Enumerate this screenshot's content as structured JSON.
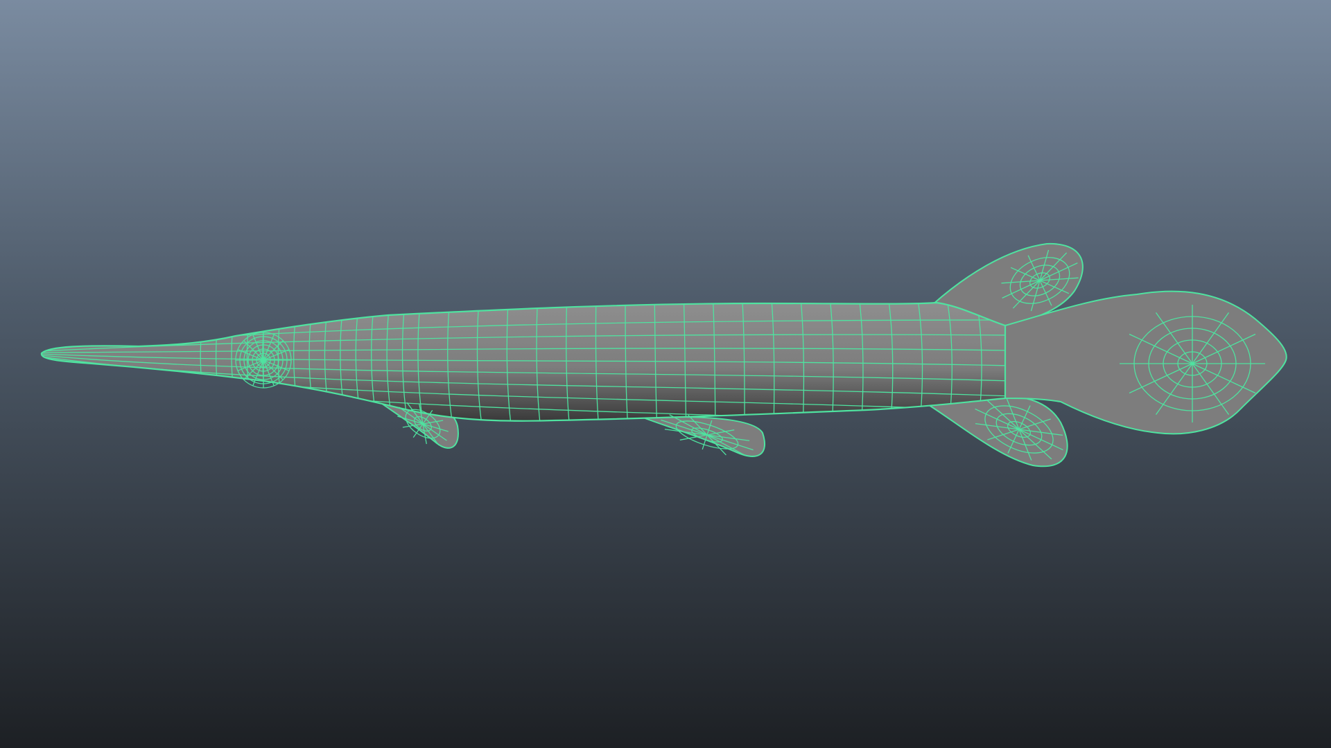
{
  "viewport": {
    "background_top": "#7a8ba0",
    "background_mid": "#4f5c6b",
    "background_bottom": "#1d2024"
  },
  "model": {
    "object": "fish-mesh",
    "display_mode": "shaded-with-wireframe-on-selected",
    "selected": true,
    "wire_color": "#4fe3a0",
    "surface_color": "#7d7d7d",
    "surface_shadow": "#3a3a3a",
    "surface_highlight": "#8e8e8e"
  }
}
